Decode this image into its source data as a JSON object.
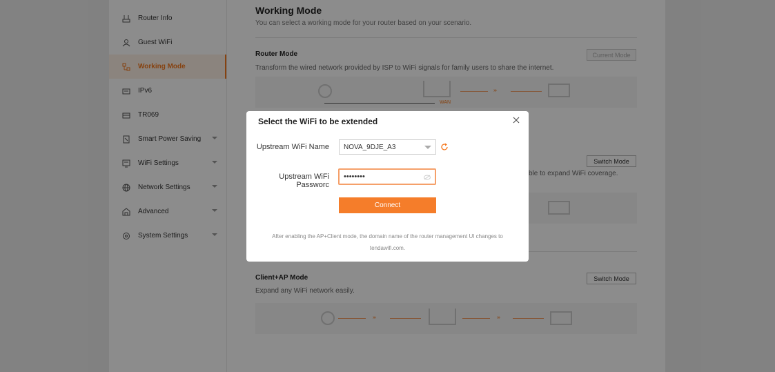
{
  "sidebar": {
    "items": [
      {
        "label": "Router Info",
        "icon": "router-icon",
        "active": false,
        "expandable": false
      },
      {
        "label": "Guest WiFi",
        "icon": "guest-icon",
        "active": false,
        "expandable": false
      },
      {
        "label": "Working Mode",
        "icon": "working-mode-icon",
        "active": true,
        "expandable": false
      },
      {
        "label": "IPv6",
        "icon": "ipv6-icon",
        "active": false,
        "expandable": false
      },
      {
        "label": "TR069",
        "icon": "tr069-icon",
        "active": false,
        "expandable": false
      },
      {
        "label": "Smart Power Saving",
        "icon": "power-icon",
        "active": false,
        "expandable": true
      },
      {
        "label": "WiFi Settings",
        "icon": "wifi-icon",
        "active": false,
        "expandable": true
      },
      {
        "label": "Network Settings",
        "icon": "globe-icon",
        "active": false,
        "expandable": true
      },
      {
        "label": "Advanced",
        "icon": "advanced-icon",
        "active": false,
        "expandable": true
      },
      {
        "label": "System Settings",
        "icon": "gear-icon",
        "active": false,
        "expandable": true
      }
    ]
  },
  "main": {
    "title": "Working Mode",
    "subtitle": "You can select a working mode for your router based on your scenario.",
    "modes": [
      {
        "title": "Router Mode",
        "desc": "Transform the wired network provided by ISP to WiFi signals for family users to share the internet.",
        "button": "Current Mode",
        "wan_label": "WAN"
      },
      {
        "title": "",
        "desc": "ble to expand WiFi coverage.",
        "button": "Switch Mode"
      },
      {
        "title": "Client+AP Mode",
        "desc": "Expand any WiFi network easily.",
        "button": "Switch Mode"
      }
    ],
    "arrow_glyph": "›››"
  },
  "modal": {
    "title": "Select the WiFi to be extended",
    "ssid_label": "Upstream WiFi Name",
    "ssid_value": "NOVA_9DJE_A3",
    "password_label": "Upstream WiFi Passworc",
    "password_value": "••••••••",
    "connect_label": "Connect",
    "note_line1": "After enabling the AP+Client mode, the domain name of the router management UI changes to",
    "note_line2": "tendawifi.com."
  },
  "colors": {
    "accent": "#f5781e",
    "active_bg": "#fdf0e6"
  }
}
